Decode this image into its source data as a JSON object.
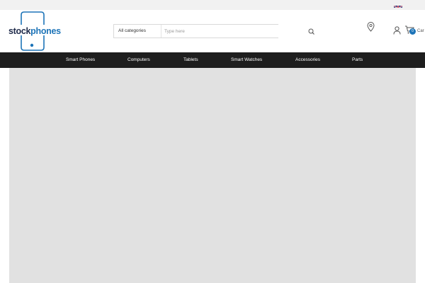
{
  "header": {
    "logo": {
      "text_main": "stock",
      "text_accent": "phones"
    },
    "search": {
      "category_label": "All categories",
      "placeholder": "Type here"
    },
    "cart": {
      "count": "0",
      "label": "Car"
    }
  },
  "nav": {
    "items": [
      {
        "label": "Smart Phones"
      },
      {
        "label": "Computers"
      },
      {
        "label": "Tablets"
      },
      {
        "label": "Smart Watches"
      },
      {
        "label": "Accessories"
      },
      {
        "label": "Parts"
      }
    ]
  },
  "colors": {
    "brand_blue": "#1d74b8",
    "logo_dark": "#1e2a4a",
    "nav_background": "#1e1e1e",
    "content_placeholder": "#e1e1e1"
  },
  "icons": {
    "language": "uk-flag-icon",
    "search": "search-icon",
    "location": "location-pin-icon",
    "account": "user-icon",
    "cart": "cart-icon"
  }
}
